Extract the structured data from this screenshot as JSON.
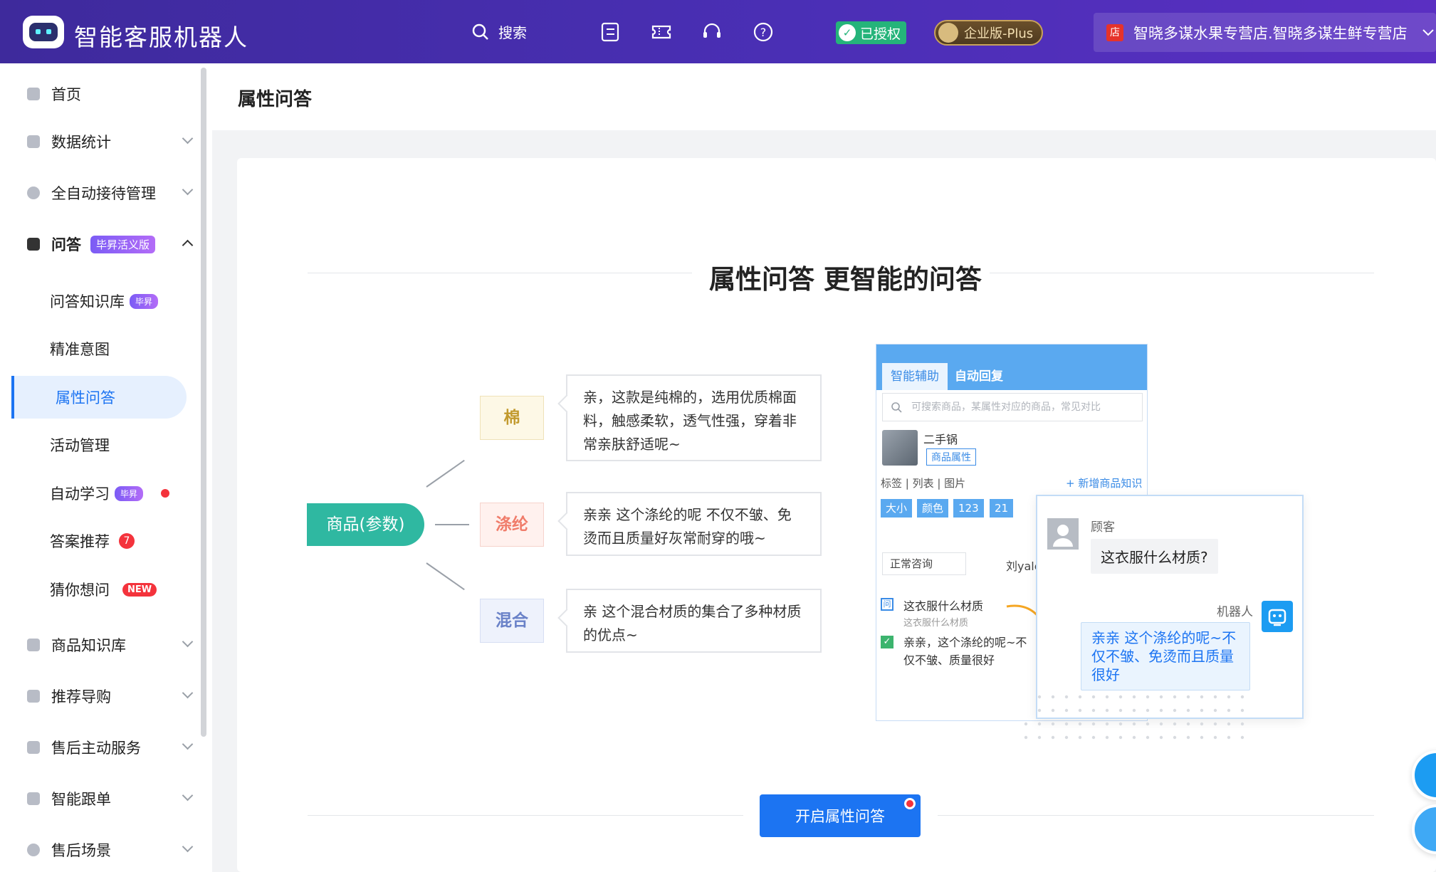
{
  "header": {
    "app_title": "智能客服机器人",
    "search_label": "搜索",
    "auth_badge": "已授权",
    "plan_badge": "企业版-Plus",
    "store_name": "智晓多谋水果专营店.智晓多谋生鲜专营店"
  },
  "sidebar": {
    "items": [
      {
        "label": "首页"
      },
      {
        "label": "数据统计"
      },
      {
        "label": "全自动接待管理"
      },
      {
        "label": "问答",
        "tag": "毕昇活义版"
      },
      {
        "label": "商品知识库"
      },
      {
        "label": "推荐导购"
      },
      {
        "label": "售后主动服务"
      },
      {
        "label": "智能跟单"
      },
      {
        "label": "售后场景"
      }
    ],
    "sub_items": [
      {
        "label": "问答知识库",
        "tag": "毕昇"
      },
      {
        "label": "精准意图"
      },
      {
        "label": "属性问答"
      },
      {
        "label": "活动管理"
      },
      {
        "label": "自动学习",
        "tag": "毕昇"
      },
      {
        "label": "答案推荐",
        "count": "7"
      },
      {
        "label": "猜你想问",
        "badge": "NEW"
      }
    ]
  },
  "page": {
    "title": "属性问答",
    "hero_title": "属性问答 更智能的问答",
    "product_node": "商品(参数)",
    "attributes": [
      {
        "name": "棉",
        "answer": "亲，这款是纯棉的，选用优质棉面料，触感柔软，透气性强，穿着非常亲肤舒适呢~",
        "color": "#c29a2e",
        "bg": "#fdf8e6",
        "border": "#efe2b8"
      },
      {
        "name": "涤纶",
        "answer": "亲亲 这个涤纶的呢 不仅不皱、免烫而且质量好灰常耐穿的哦~",
        "color": "#f07c6a",
        "bg": "#fff1ee",
        "border": "#f6d3cc"
      },
      {
        "name": "混合",
        "answer": "亲 这个混合材质的集合了多种材质的优点~",
        "color": "#6a82c8",
        "bg": "#eef2fc",
        "border": "#d6def3"
      }
    ],
    "mock": {
      "tab_assist": "智能辅助",
      "tab_auto": "自动回复",
      "search_placeholder": "可搜索商品，某属性对应的商品，常见对比",
      "product_name": "二手锅",
      "product_tag": "商品属性",
      "filters": "标签 | 列表 | 图片",
      "add_knowledge": "+ 新增商品知识",
      "chips": [
        "大小",
        "颜色",
        "123",
        "21"
      ],
      "consult_type": "正常咨询",
      "agent_name": "刘yale",
      "q_title": "这衣服什么材质",
      "q_sub": "这衣服什么材质",
      "a_text": "亲亲，这个涤纶的呢~不仅不皱、质量很好"
    },
    "popup": {
      "customer_label": "顾客",
      "customer_msg": "这衣服什么材质?",
      "bot_label": "机器人",
      "bot_msg": "亲亲 这个涤纶的呢~不仅不皱、免烫而且质量很好"
    },
    "enable_button": "开启属性问答"
  }
}
